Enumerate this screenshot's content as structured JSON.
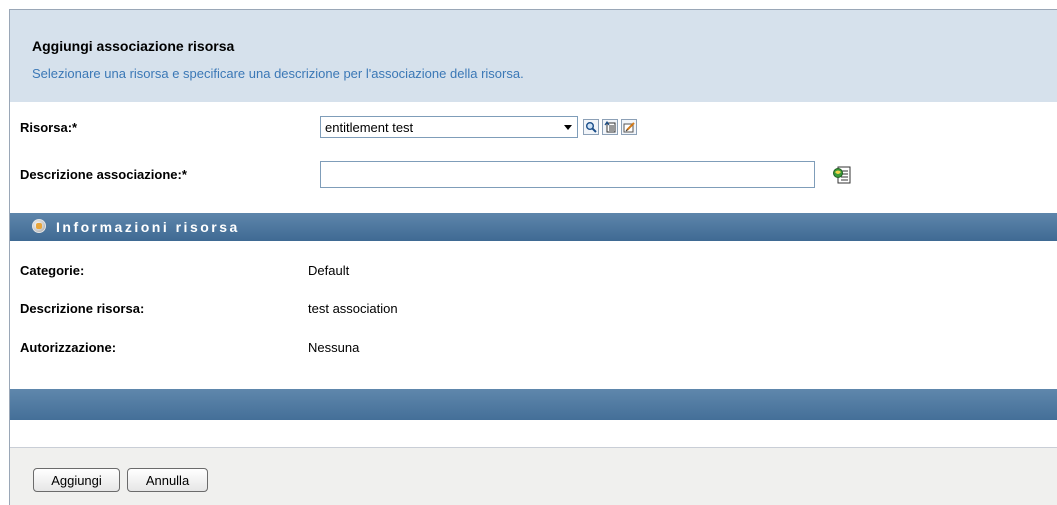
{
  "header": {
    "title": "Aggiungi associazione risorsa",
    "subtitle": "Selezionare una risorsa e specificare una descrizione per l'associazione della risorsa."
  },
  "form": {
    "risorsa_label": "Risorsa:*",
    "risorsa_value": "entitlement test",
    "descrizione_label": "Descrizione associazione:*",
    "descrizione_value": ""
  },
  "toolbar_icons": [
    "search-icon",
    "details-icon",
    "edit-icon",
    "localize-icon"
  ],
  "section": {
    "title": "Informazioni risorsa",
    "rows": [
      {
        "label": "Categorie:",
        "value": "Default"
      },
      {
        "label": "Descrizione risorsa:",
        "value": "test association"
      },
      {
        "label": "Autorizzazione:",
        "value": "Nessuna"
      }
    ]
  },
  "buttons": {
    "add": "Aggiungi",
    "cancel": "Annulla"
  },
  "colors": {
    "header_bg": "#d6e1ec",
    "subtitle": "#3b78b6",
    "section_bar": "#4f79a0"
  }
}
